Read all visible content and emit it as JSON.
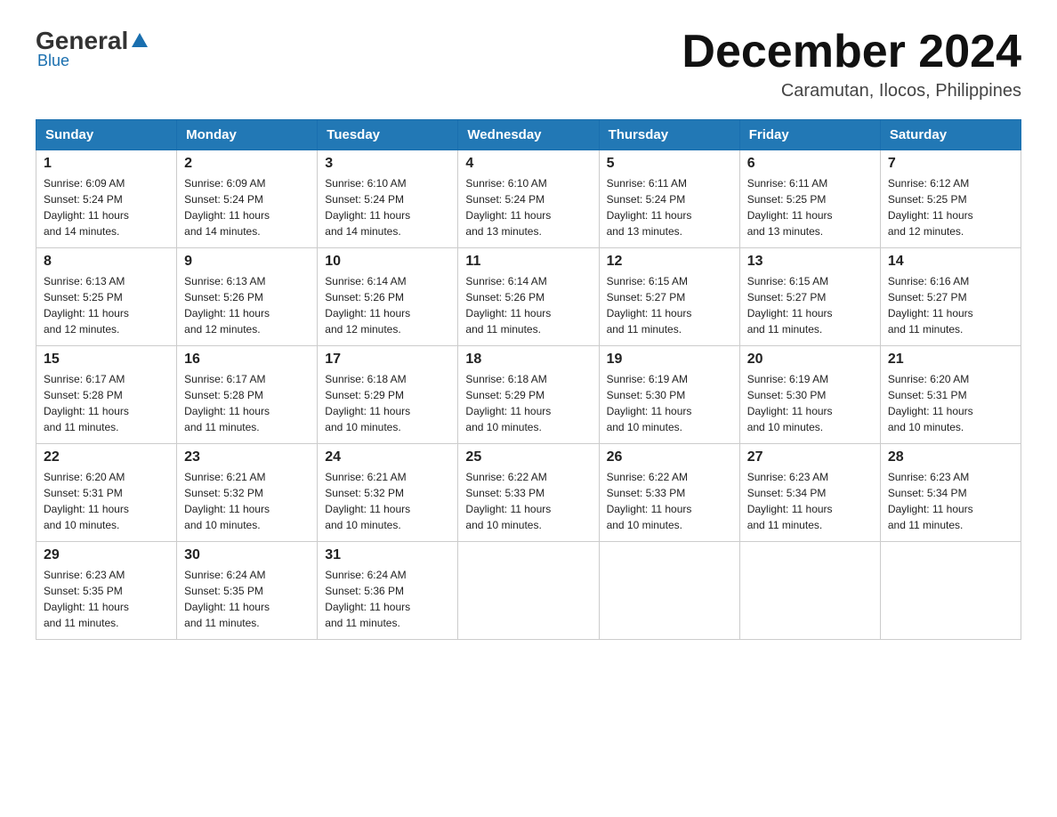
{
  "logo": {
    "general": "General",
    "blue": "Blue"
  },
  "header": {
    "month": "December 2024",
    "location": "Caramutan, Ilocos, Philippines"
  },
  "weekdays": [
    "Sunday",
    "Monday",
    "Tuesday",
    "Wednesday",
    "Thursday",
    "Friday",
    "Saturday"
  ],
  "weeks": [
    [
      {
        "day": "1",
        "sunrise": "6:09 AM",
        "sunset": "5:24 PM",
        "daylight": "11 hours and 14 minutes."
      },
      {
        "day": "2",
        "sunrise": "6:09 AM",
        "sunset": "5:24 PM",
        "daylight": "11 hours and 14 minutes."
      },
      {
        "day": "3",
        "sunrise": "6:10 AM",
        "sunset": "5:24 PM",
        "daylight": "11 hours and 14 minutes."
      },
      {
        "day": "4",
        "sunrise": "6:10 AM",
        "sunset": "5:24 PM",
        "daylight": "11 hours and 13 minutes."
      },
      {
        "day": "5",
        "sunrise": "6:11 AM",
        "sunset": "5:24 PM",
        "daylight": "11 hours and 13 minutes."
      },
      {
        "day": "6",
        "sunrise": "6:11 AM",
        "sunset": "5:25 PM",
        "daylight": "11 hours and 13 minutes."
      },
      {
        "day": "7",
        "sunrise": "6:12 AM",
        "sunset": "5:25 PM",
        "daylight": "11 hours and 12 minutes."
      }
    ],
    [
      {
        "day": "8",
        "sunrise": "6:13 AM",
        "sunset": "5:25 PM",
        "daylight": "11 hours and 12 minutes."
      },
      {
        "day": "9",
        "sunrise": "6:13 AM",
        "sunset": "5:26 PM",
        "daylight": "11 hours and 12 minutes."
      },
      {
        "day": "10",
        "sunrise": "6:14 AM",
        "sunset": "5:26 PM",
        "daylight": "11 hours and 12 minutes."
      },
      {
        "day": "11",
        "sunrise": "6:14 AM",
        "sunset": "5:26 PM",
        "daylight": "11 hours and 11 minutes."
      },
      {
        "day": "12",
        "sunrise": "6:15 AM",
        "sunset": "5:27 PM",
        "daylight": "11 hours and 11 minutes."
      },
      {
        "day": "13",
        "sunrise": "6:15 AM",
        "sunset": "5:27 PM",
        "daylight": "11 hours and 11 minutes."
      },
      {
        "day": "14",
        "sunrise": "6:16 AM",
        "sunset": "5:27 PM",
        "daylight": "11 hours and 11 minutes."
      }
    ],
    [
      {
        "day": "15",
        "sunrise": "6:17 AM",
        "sunset": "5:28 PM",
        "daylight": "11 hours and 11 minutes."
      },
      {
        "day": "16",
        "sunrise": "6:17 AM",
        "sunset": "5:28 PM",
        "daylight": "11 hours and 11 minutes."
      },
      {
        "day": "17",
        "sunrise": "6:18 AM",
        "sunset": "5:29 PM",
        "daylight": "11 hours and 10 minutes."
      },
      {
        "day": "18",
        "sunrise": "6:18 AM",
        "sunset": "5:29 PM",
        "daylight": "11 hours and 10 minutes."
      },
      {
        "day": "19",
        "sunrise": "6:19 AM",
        "sunset": "5:30 PM",
        "daylight": "11 hours and 10 minutes."
      },
      {
        "day": "20",
        "sunrise": "6:19 AM",
        "sunset": "5:30 PM",
        "daylight": "11 hours and 10 minutes."
      },
      {
        "day": "21",
        "sunrise": "6:20 AM",
        "sunset": "5:31 PM",
        "daylight": "11 hours and 10 minutes."
      }
    ],
    [
      {
        "day": "22",
        "sunrise": "6:20 AM",
        "sunset": "5:31 PM",
        "daylight": "11 hours and 10 minutes."
      },
      {
        "day": "23",
        "sunrise": "6:21 AM",
        "sunset": "5:32 PM",
        "daylight": "11 hours and 10 minutes."
      },
      {
        "day": "24",
        "sunrise": "6:21 AM",
        "sunset": "5:32 PM",
        "daylight": "11 hours and 10 minutes."
      },
      {
        "day": "25",
        "sunrise": "6:22 AM",
        "sunset": "5:33 PM",
        "daylight": "11 hours and 10 minutes."
      },
      {
        "day": "26",
        "sunrise": "6:22 AM",
        "sunset": "5:33 PM",
        "daylight": "11 hours and 10 minutes."
      },
      {
        "day": "27",
        "sunrise": "6:23 AM",
        "sunset": "5:34 PM",
        "daylight": "11 hours and 11 minutes."
      },
      {
        "day": "28",
        "sunrise": "6:23 AM",
        "sunset": "5:34 PM",
        "daylight": "11 hours and 11 minutes."
      }
    ],
    [
      {
        "day": "29",
        "sunrise": "6:23 AM",
        "sunset": "5:35 PM",
        "daylight": "11 hours and 11 minutes."
      },
      {
        "day": "30",
        "sunrise": "6:24 AM",
        "sunset": "5:35 PM",
        "daylight": "11 hours and 11 minutes."
      },
      {
        "day": "31",
        "sunrise": "6:24 AM",
        "sunset": "5:36 PM",
        "daylight": "11 hours and 11 minutes."
      },
      null,
      null,
      null,
      null
    ]
  ],
  "labels": {
    "sunrise": "Sunrise:",
    "sunset": "Sunset:",
    "daylight": "Daylight:"
  }
}
